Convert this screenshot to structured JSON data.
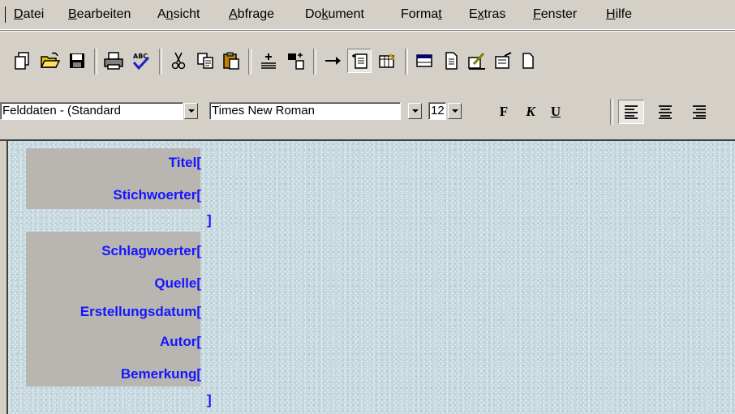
{
  "menubar": {
    "items": [
      {
        "label": "Datei",
        "accel": "D",
        "rest": "atei"
      },
      {
        "label": "Bearbeiten",
        "accel": "B",
        "rest": "earbeiten"
      },
      {
        "label": "Ansicht",
        "pre": "A",
        "accel": "n",
        "rest": "sicht"
      },
      {
        "label": "Abfrage",
        "accel": "A",
        "rest": "bfrage"
      },
      {
        "label": "Dokument",
        "pre": "Do",
        "accel": "k",
        "rest": "ument"
      },
      {
        "label": "Format",
        "pre": "Forma",
        "accel": "t",
        "rest": ""
      },
      {
        "label": "Extras",
        "pre": "E",
        "accel": "x",
        "rest": "tras"
      },
      {
        "label": "Fenster",
        "accel": "F",
        "rest": "enster"
      },
      {
        "label": "Hilfe",
        "accel": "H",
        "rest": "ilfe"
      }
    ]
  },
  "toolbar": {
    "buttons": [
      "new-document-icon",
      "open-folder-icon",
      "save-icon",
      "print-icon",
      "spellcheck-icon",
      "cut-icon",
      "copy-icon",
      "paste-icon",
      "insert-field-icon",
      "record-icon",
      "arrow-right-icon",
      "form-view-icon",
      "query-icon",
      "window-icon",
      "page-icon",
      "edit-icon",
      "design-icon",
      "blank-page-icon"
    ]
  },
  "formatbar": {
    "style_value": "Felddaten - (Standard",
    "font_value": "Times New Roman",
    "size_value": "12",
    "bold_label": "F",
    "italic_label": "K",
    "underline_label": "U"
  },
  "document": {
    "fields": [
      {
        "label": "Titel["
      },
      {
        "label": "Stichwoerter["
      },
      {
        "label": "Schlagwoerter["
      },
      {
        "label": "Quelle["
      },
      {
        "label": "Erstellungsdatum["
      },
      {
        "label": "Autor["
      },
      {
        "label": "Bemerkung["
      }
    ],
    "close_bracket_1": "]",
    "close_bracket_2": "]"
  },
  "colors": {
    "field_label": "#1515ff",
    "label_background": "#b9b6b2",
    "document_background": "#c7d8df",
    "chrome": "#d4d0c8"
  }
}
